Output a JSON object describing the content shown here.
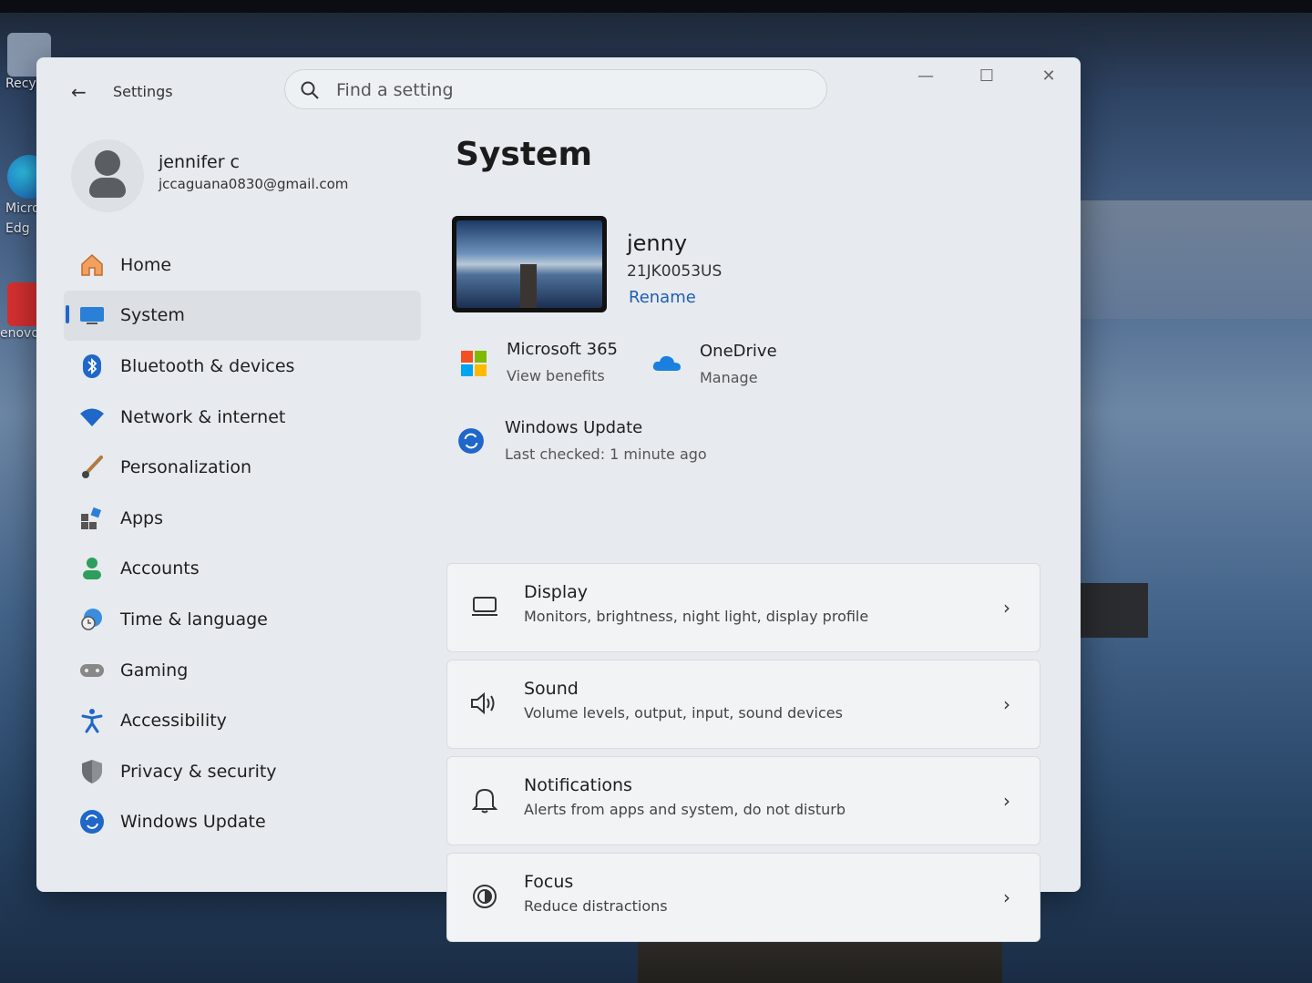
{
  "desktop": {
    "icons": [
      {
        "label": "Recycle"
      },
      {
        "label": "Micros\nEdg"
      },
      {
        "label": "enovo"
      }
    ]
  },
  "window": {
    "app_title": "Settings",
    "search_placeholder": "Find a setting",
    "controls": {
      "minimize": "—",
      "maximize": "☐",
      "close": "✕"
    }
  },
  "profile": {
    "name": "jennifer c",
    "email": "jccaguana0830@gmail.com"
  },
  "sidebar": {
    "items": [
      {
        "label": "Home",
        "icon": "home-icon"
      },
      {
        "label": "System",
        "icon": "system-icon",
        "active": true
      },
      {
        "label": "Bluetooth & devices",
        "icon": "bluetooth-icon"
      },
      {
        "label": "Network & internet",
        "icon": "wifi-icon"
      },
      {
        "label": "Personalization",
        "icon": "brush-icon"
      },
      {
        "label": "Apps",
        "icon": "apps-icon"
      },
      {
        "label": "Accounts",
        "icon": "accounts-icon"
      },
      {
        "label": "Time & language",
        "icon": "globe-clock-icon"
      },
      {
        "label": "Gaming",
        "icon": "gamepad-icon"
      },
      {
        "label": "Accessibility",
        "icon": "accessibility-icon"
      },
      {
        "label": "Privacy & security",
        "icon": "shield-icon"
      },
      {
        "label": "Windows Update",
        "icon": "update-icon"
      }
    ]
  },
  "main": {
    "title": "System",
    "device": {
      "name": "jenny",
      "model": "21JK0053US",
      "rename": "Rename"
    },
    "quick": {
      "m365": {
        "title": "Microsoft 365",
        "sub": "View benefits"
      },
      "onedrive": {
        "title": "OneDrive",
        "sub": "Manage"
      },
      "update": {
        "title": "Windows Update",
        "sub": "Last checked: 1 minute ago"
      }
    },
    "cards": [
      {
        "title": "Display",
        "sub": "Monitors, brightness, night light, display profile",
        "icon": "display-icon"
      },
      {
        "title": "Sound",
        "sub": "Volume levels, output, input, sound devices",
        "icon": "speaker-icon"
      },
      {
        "title": "Notifications",
        "sub": "Alerts from apps and system, do not disturb",
        "icon": "bell-icon"
      },
      {
        "title": "Focus",
        "sub": "Reduce distractions",
        "icon": "focus-icon"
      }
    ]
  },
  "colors": {
    "accent": "#1f67c9",
    "window_bg": "#e7eaee"
  }
}
